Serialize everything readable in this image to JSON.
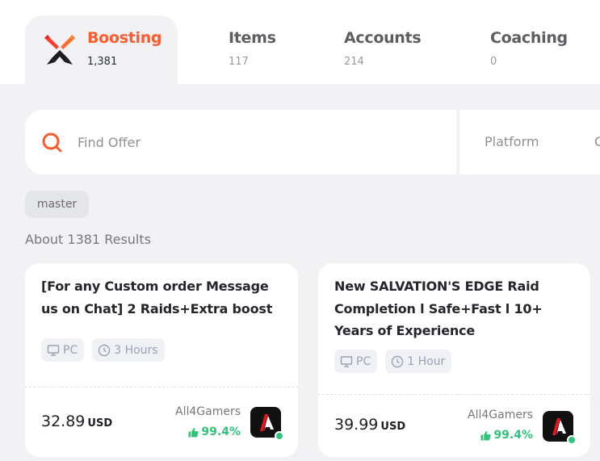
{
  "tabs": [
    {
      "label": "Boosting",
      "count": "1,381",
      "icon": "crossed-swords-icon",
      "active": true
    },
    {
      "label": "Items",
      "count": "117",
      "active": false
    },
    {
      "label": "Accounts",
      "count": "214",
      "active": false
    },
    {
      "label": "Coaching",
      "count": "0",
      "active": false
    }
  ],
  "search": {
    "placeholder": "Find Offer",
    "value": "",
    "icon": "search-icon"
  },
  "filters": {
    "platform_label": "Platform",
    "next_label_partial": "C"
  },
  "active_chip": "master",
  "results_text": "About 1381 Results",
  "colors": {
    "accent": "#ff5a2c",
    "rating_green": "#2ec47a",
    "tag_text": "#9aa1b4",
    "background": "#f2f2f4"
  },
  "offers": [
    {
      "title": "[For any Custom order Message us on Chat] 2 Raids+Extra boost",
      "platform": "PC",
      "delivery_time": "3 Hours",
      "price": "32.89",
      "currency": "USD",
      "seller": "All4Gamers",
      "rating": "99.4%",
      "online": true
    },
    {
      "title": "New SALVATION'S EDGE Raid Completion l Safe+Fast l 10+ Years of Experience",
      "platform": "PC",
      "delivery_time": "1 Hour",
      "price": "39.99",
      "currency": "USD",
      "seller": "All4Gamers",
      "rating": "99.4%",
      "online": true
    }
  ]
}
